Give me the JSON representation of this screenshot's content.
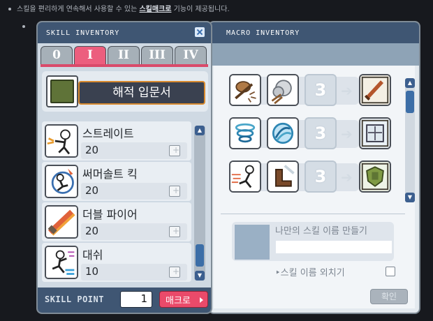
{
  "intro": {
    "text_before": "스킬을 편리하게 연속해서 사용할 수 있는 ",
    "link": "스킬매크로",
    "text_after": " 기능이 제공됩니다."
  },
  "skill_window": {
    "title": "SKILL INVENTORY",
    "tabs": [
      "0",
      "I",
      "II",
      "III",
      "IV"
    ],
    "active_tab": "I",
    "book_name": "해적 입문서",
    "skills": [
      {
        "name": "스트레이트",
        "level": "20",
        "icon": "straight-punch-icon"
      },
      {
        "name": "써머솔트 킥",
        "level": "20",
        "icon": "somersault-kick-icon"
      },
      {
        "name": "더블 파이어",
        "level": "20",
        "icon": "double-fire-icon"
      },
      {
        "name": "대쉬",
        "level": "10",
        "icon": "dash-icon"
      }
    ],
    "skill_point_label": "SKILL POINT",
    "skill_point_value": "1",
    "macro_button": "매크로"
  },
  "macro_window": {
    "title": "MACRO INVENTORY",
    "rows": [
      {
        "slot1": "brown-skill-icon",
        "slot2": "cloud-burst-icon",
        "slot3": "3",
        "result": "sword-macro-icon"
      },
      {
        "slot1": "whirlwind-icon",
        "slot2": "blue-energy-icon",
        "slot3": "3",
        "result": "book-macro-icon"
      },
      {
        "slot1": "dash-skill-icon",
        "slot2": "boot-skill-icon",
        "slot3": "3",
        "result": "shield-macro-icon"
      }
    ],
    "name_label": "나만의 스킬 이름 만들기",
    "name_value": "",
    "shout_label": "스킬 이름 외치기",
    "shout_checked": false,
    "confirm_button": "확인"
  }
}
